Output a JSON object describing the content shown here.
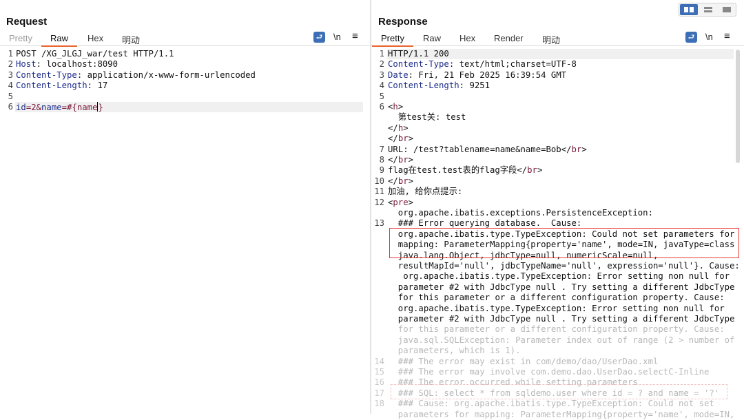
{
  "request": {
    "title": "Request",
    "tabs": [
      "Pretty",
      "Raw",
      "Hex",
      "明动"
    ],
    "wrap_label": "≡",
    "newline_label": "\\n",
    "menu_label": "≡",
    "lines": [
      {
        "n": "1",
        "parts": [
          [
            "",
            "POST /XG_JLGJ_war/test HTTP/1.1"
          ]
        ]
      },
      {
        "n": "2",
        "parts": [
          [
            "k",
            "Host"
          ],
          [
            "",
            ": localhost:8090"
          ]
        ]
      },
      {
        "n": "3",
        "parts": [
          [
            "k",
            "Content-Type"
          ],
          [
            "",
            ": application/x-www-form-urlencoded"
          ]
        ]
      },
      {
        "n": "4",
        "parts": [
          [
            "k",
            "Content-Length"
          ],
          [
            "",
            ": 17"
          ]
        ]
      },
      {
        "n": "5",
        "parts": [
          [
            "",
            ""
          ]
        ]
      },
      {
        "n": "6",
        "parts": [
          [
            "k",
            "id"
          ],
          [
            "tagc",
            "=2&"
          ],
          [
            "k",
            "name"
          ],
          [
            "tagc",
            "=#{name"
          ],
          [
            "cursor",
            ""
          ],
          [
            "tagc",
            "}"
          ]
        ]
      }
    ]
  },
  "response": {
    "title": "Response",
    "tabs": [
      "Pretty",
      "Raw",
      "Hex",
      "Render",
      "明动"
    ],
    "lines": [
      {
        "n": "1",
        "t": [
          [
            "",
            "HTTP/1.1 200"
          ]
        ]
      },
      {
        "n": "2",
        "t": [
          [
            "k",
            "Content-Type"
          ],
          [
            "",
            ": text/html;charset=UTF-8"
          ]
        ]
      },
      {
        "n": "3",
        "t": [
          [
            "k",
            "Date"
          ],
          [
            "",
            ": Fri, 21 Feb 2025 16:39:54 GMT"
          ]
        ]
      },
      {
        "n": "4",
        "t": [
          [
            "k",
            "Content-Length"
          ],
          [
            "",
            ": 9251"
          ]
        ]
      },
      {
        "n": "5",
        "t": [
          [
            "",
            ""
          ]
        ]
      },
      {
        "n": "6",
        "t": [
          [
            "",
            "<"
          ],
          [
            "tagc",
            "h"
          ],
          [
            "",
            ">"
          ]
        ]
      },
      {
        "n": "",
        "t": [
          [
            "",
            "  第test关: test"
          ]
        ]
      },
      {
        "n": "",
        "t": [
          [
            "",
            "</"
          ],
          [
            "tagc",
            "h"
          ],
          [
            "",
            ">"
          ]
        ]
      },
      {
        "n": "",
        "t": [
          [
            "",
            "</"
          ],
          [
            "tagc",
            "br"
          ],
          [
            "",
            ">"
          ]
        ]
      },
      {
        "n": "7",
        "t": [
          [
            "",
            "URL: /test?tablename=name&name=Bob</"
          ],
          [
            "tagc",
            "br"
          ],
          [
            "",
            ">"
          ]
        ]
      },
      {
        "n": "8",
        "t": [
          [
            "",
            "</"
          ],
          [
            "tagc",
            "br"
          ],
          [
            "",
            ">"
          ]
        ]
      },
      {
        "n": "9",
        "t": [
          [
            "",
            "flag在test.test表的flag字段</"
          ],
          [
            "tagc",
            "br"
          ],
          [
            "",
            ">"
          ]
        ]
      },
      {
        "n": "10",
        "t": [
          [
            "",
            "</"
          ],
          [
            "tagc",
            "br"
          ],
          [
            "",
            ">"
          ]
        ]
      },
      {
        "n": "11",
        "t": [
          [
            "",
            "加油, 给你点提示:"
          ]
        ]
      },
      {
        "n": "12",
        "t": [
          [
            "",
            "<"
          ],
          [
            "tagc",
            "pre"
          ],
          [
            "",
            ">"
          ]
        ]
      },
      {
        "n": "",
        "t": [
          [
            "",
            "  org.apache.ibatis.exceptions.PersistenceException:"
          ]
        ]
      },
      {
        "n": "13",
        "t": [
          [
            "",
            "  ### Error querying database.  Cause:"
          ]
        ]
      },
      {
        "n": "",
        "t": [
          [
            "",
            "  org.apache.ibatis.type.TypeException: Could not set parameters for"
          ]
        ]
      },
      {
        "n": "",
        "t": [
          [
            "",
            "  mapping: ParameterMapping{property='name', mode=IN, javaType=class"
          ]
        ]
      },
      {
        "n": "",
        "t": [
          [
            "",
            "  java.lang.Object, jdbcType=null, numericScale=null,"
          ]
        ]
      },
      {
        "n": "",
        "t": [
          [
            "",
            "  resultMapId='null', jdbcTypeName='null', expression='null'}. Cause:"
          ]
        ]
      },
      {
        "n": "",
        "t": [
          [
            "",
            "   org.apache.ibatis.type.TypeException: Error setting non null for"
          ]
        ]
      },
      {
        "n": "",
        "t": [
          [
            "",
            "  parameter #2 with JdbcType null . Try setting a different JdbcType"
          ]
        ]
      },
      {
        "n": "",
        "t": [
          [
            "",
            "  for this parameter or a different configuration property. Cause:"
          ]
        ]
      },
      {
        "n": "",
        "t": [
          [
            "",
            "  org.apache.ibatis.type.TypeException: Error setting non null for"
          ]
        ]
      },
      {
        "n": "",
        "t": [
          [
            "",
            "  parameter #2 with JdbcType null . Try setting a different JdbcType"
          ]
        ]
      },
      {
        "n": "",
        "t": [
          [
            "fade",
            "  for this parameter or a different configuration property. Cause:"
          ]
        ]
      },
      {
        "n": "",
        "t": [
          [
            "fade",
            "  java.sql.SQLException: Parameter index out of range (2 > number of"
          ]
        ]
      },
      {
        "n": "",
        "t": [
          [
            "fade",
            "  parameters, which is 1)."
          ]
        ]
      },
      {
        "n": "14",
        "f": true,
        "t": [
          [
            "fade",
            "  ### The error may exist in com/demo/dao/UserDao.xml"
          ]
        ]
      },
      {
        "n": "15",
        "f": true,
        "t": [
          [
            "fade",
            "  ### The error may involve com.demo.dao.UserDao.selectC-Inline"
          ]
        ]
      },
      {
        "n": "16",
        "f": true,
        "t": [
          [
            "fade",
            "  ### The error occurred while setting parameters"
          ]
        ]
      },
      {
        "n": "17",
        "f": true,
        "t": [
          [
            "fade",
            "  ### SQL: select * from sqldemo.user where id = ? and name = '?'"
          ]
        ]
      },
      {
        "n": "18",
        "f": true,
        "t": [
          [
            "fade",
            "  ### Cause: org.apache.ibatis.type.TypeException: Could not set"
          ]
        ]
      },
      {
        "n": "",
        "t": [
          [
            "fade",
            "  parameters for mapping: ParameterMapping{property='name', mode=IN,"
          ]
        ]
      }
    ]
  }
}
